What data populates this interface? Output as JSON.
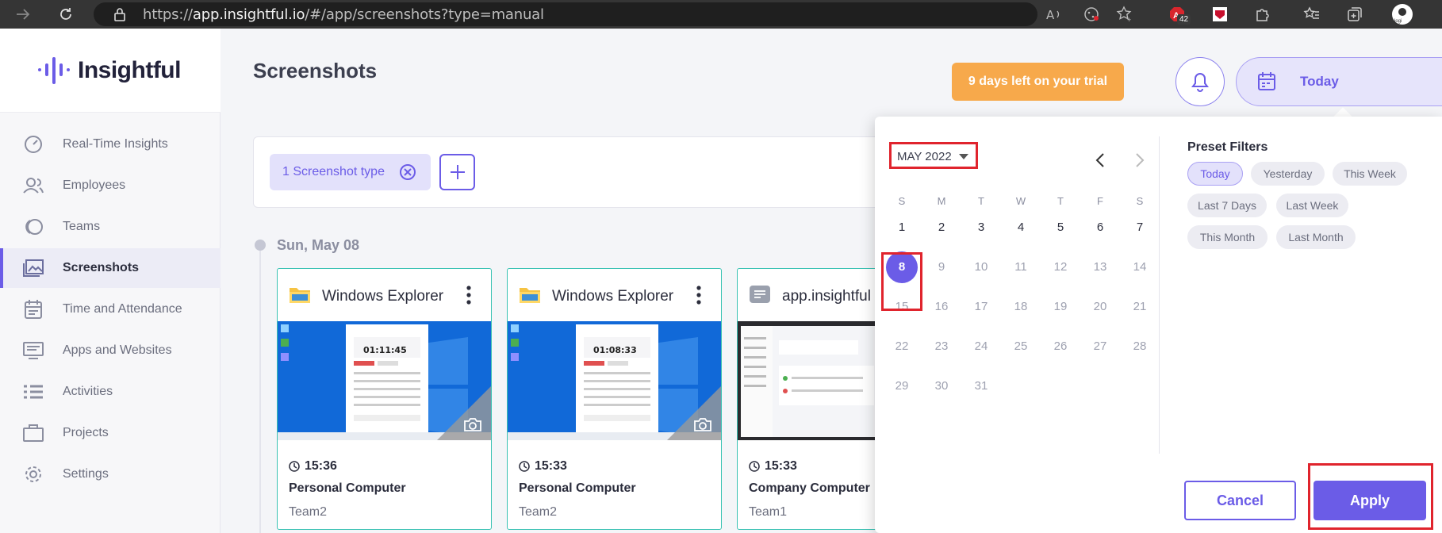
{
  "browser": {
    "url_prefix": "https://",
    "url_domain": "app.insightful.io",
    "url_path": "/#/app/screenshots?type=manual",
    "extension_badge": "42"
  },
  "sidebar": {
    "logo": "Insightful",
    "items": [
      {
        "label": "Real-Time Insights",
        "icon": "dashboard-gauge-icon"
      },
      {
        "label": "Employees",
        "icon": "people-icon"
      },
      {
        "label": "Teams",
        "icon": "teams-icon"
      },
      {
        "label": "Screenshots",
        "icon": "images-icon",
        "active": true
      },
      {
        "label": "Time and Attendance",
        "icon": "calendar-icon"
      },
      {
        "label": "Apps and Websites",
        "icon": "monitor-list-icon"
      },
      {
        "label": "Activities",
        "icon": "list-icon"
      },
      {
        "label": "Projects",
        "icon": "briefcase-icon"
      },
      {
        "label": "Settings",
        "icon": "gear-icon"
      }
    ]
  },
  "header": {
    "title": "Screenshots",
    "trial": "9 days left on your trial",
    "date_button": "Today"
  },
  "filters": {
    "chip_label": "1 Screenshot type"
  },
  "timeline": {
    "date": "Sun, May 08",
    "cards": [
      {
        "app": "Windows Explorer",
        "time": "15:36",
        "computer": "Personal Computer",
        "team": "Team2",
        "clock": "01:11:45"
      },
      {
        "app": "Windows Explorer",
        "time": "15:33",
        "computer": "Personal Computer",
        "team": "Team2",
        "clock": "01:08:33"
      },
      {
        "app": "app.insightful",
        "time": "15:33",
        "computer": "Company Computer",
        "team": "Team1"
      }
    ]
  },
  "datepicker": {
    "month": "MAY 2022",
    "weekdays": [
      "S",
      "M",
      "T",
      "W",
      "T",
      "F",
      "S"
    ],
    "days": [
      [
        "1",
        "2",
        "3",
        "4",
        "5",
        "6",
        "7"
      ],
      [
        "8",
        "9",
        "10",
        "11",
        "12",
        "13",
        "14"
      ],
      [
        "15",
        "16",
        "17",
        "18",
        "19",
        "20",
        "21"
      ],
      [
        "22",
        "23",
        "24",
        "25",
        "26",
        "27",
        "28"
      ],
      [
        "29",
        "30",
        "31"
      ]
    ],
    "selected_day": "8",
    "preset_title": "Preset Filters",
    "presets": [
      {
        "label": "Today",
        "active": true
      },
      {
        "label": "Yesterday"
      },
      {
        "label": "This Week"
      },
      {
        "label": "Last 7 Days"
      },
      {
        "label": "Last Week"
      },
      {
        "label": "This Month"
      },
      {
        "label": "Last Month"
      }
    ],
    "cancel": "Cancel",
    "apply": "Apply"
  },
  "colors": {
    "accent": "#6b5ce7",
    "trial": "#f7a94b",
    "card_border": "#39c2b3",
    "highlight": "#e0242d"
  }
}
